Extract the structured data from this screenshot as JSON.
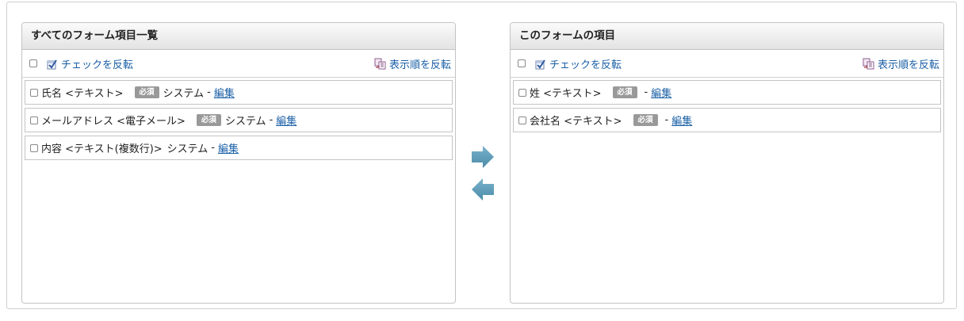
{
  "left_panel": {
    "title": "すべてのフォーム項目一覧",
    "invert_check_label": "チェックを反転",
    "invert_order_label": "表示順を反転",
    "items": [
      {
        "name": "氏名 <テキスト>",
        "badge": "必須",
        "system": "システム",
        "separator": "-",
        "edit": "編集"
      },
      {
        "name": "メールアドレス <電子メール>",
        "badge": "必須",
        "system": "システム",
        "separator": "-",
        "edit": "編集"
      },
      {
        "name": "内容 <テキスト(複数行)>",
        "system": "システム",
        "separator": "-",
        "edit": "編集"
      }
    ]
  },
  "right_panel": {
    "title": "このフォームの項目",
    "invert_check_label": "チェックを反転",
    "invert_order_label": "表示順を反転",
    "items": [
      {
        "name": "姓 <テキスト>",
        "badge": "必須",
        "separator": "-",
        "edit": "編集"
      },
      {
        "name": "会社名 <テキスト>",
        "badge": "必須",
        "separator": "-",
        "edit": "編集"
      }
    ]
  },
  "icons": {
    "move_right": "arrow-right-icon",
    "move_left": "arrow-left-icon",
    "invert_check": "check-invert-icon",
    "invert_order": "order-invert-icon"
  },
  "colors": {
    "link": "#1a5fa6",
    "arrow": "#5a9ab6",
    "badge": "#999999"
  }
}
